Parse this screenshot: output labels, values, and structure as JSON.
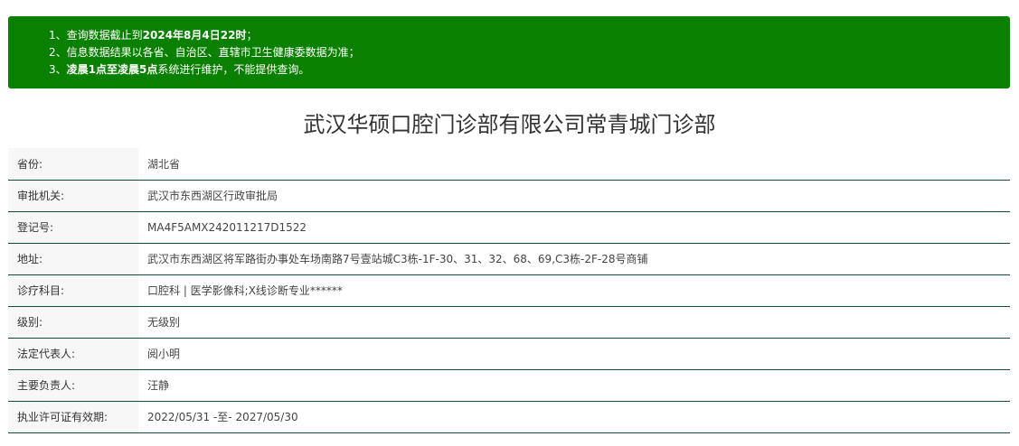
{
  "notice": {
    "items": [
      {
        "prefix": "1、查询数据截止到",
        "bold": "2024年8月4日22时",
        "suffix": "；"
      },
      {
        "prefix": "2、信息数据结果以各省、自治区、直辖市卫生健康委数据为准；",
        "bold": "",
        "suffix": ""
      },
      {
        "prefix": "3、",
        "bold": "凌晨1点至凌晨5点",
        "suffix": "系统进行维护，不能提供查询。"
      }
    ]
  },
  "title": "武汉华硕口腔门诊部有限公司常青城门诊部",
  "rows": [
    {
      "label": "省份:",
      "value": "湖北省"
    },
    {
      "label": "审批机关:",
      "value": "武汉市东西湖区行政审批局"
    },
    {
      "label": "登记号:",
      "value": "MA4F5AMX242011217D1522"
    },
    {
      "label": "地址:",
      "value": "武汉市东西湖区将军路街办事处车场南路7号壹站城C3栋-1F-30、31、32、68、69,C3栋-2F-28号商铺"
    },
    {
      "label": "诊疗科目:",
      "value": "口腔科 | 医学影像科;X线诊断专业******"
    },
    {
      "label": "级别:",
      "value": "无级别"
    },
    {
      "label": "法定代表人:",
      "value": "阅小明"
    },
    {
      "label": "主要负责人:",
      "value": "汪静"
    },
    {
      "label": "执业许可证有效期:",
      "value": "2022/05/31 -至- 2027/05/30"
    }
  ],
  "colors": {
    "notice_bg": "#0a8000",
    "row_divider": "#0e4d3a",
    "label_bg": "#f7f7f7"
  }
}
